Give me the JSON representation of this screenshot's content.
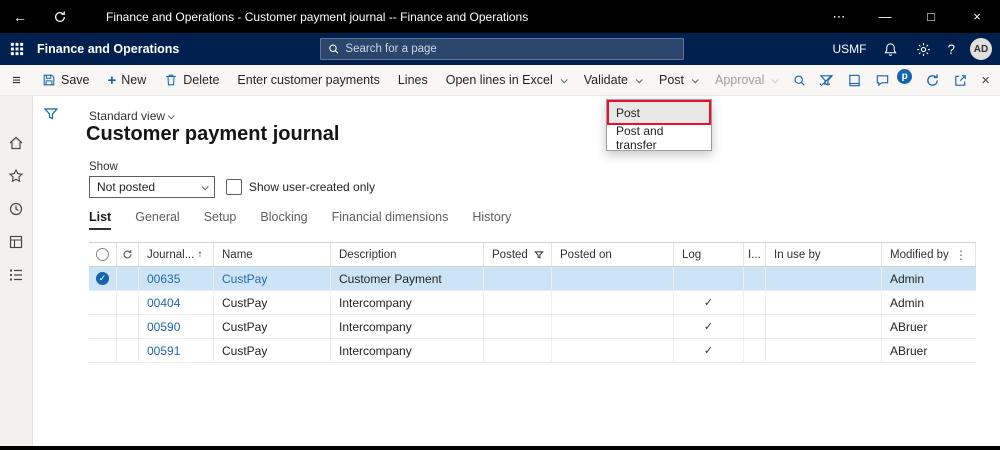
{
  "titlebar": {
    "title": "Finance and Operations - Customer payment journal -- Finance and Operations",
    "back": "←",
    "more": "⋯",
    "minimize": "—",
    "maximize": "□",
    "close": "×"
  },
  "navbar": {
    "app_name": "Finance and Operations",
    "search_placeholder": "Search for a page",
    "company": "USMF",
    "help": "?",
    "avatar_initials": "AD"
  },
  "actionbar": {
    "save": "Save",
    "new_plus": "+",
    "new": "New",
    "delete": "Delete",
    "enter_customer_payments": "Enter customer payments",
    "lines": "Lines",
    "open_lines_in_excel": "Open lines in Excel",
    "validate": "Validate",
    "post": "Post",
    "approval": "Approval",
    "overflow": "…",
    "badge": "p",
    "close": "×"
  },
  "post_menu": {
    "post": "Post",
    "post_and_transfer": "Post and transfer"
  },
  "page": {
    "view_selector": "Standard view",
    "title": "Customer payment journal",
    "show_label": "Show",
    "show_filter_value": "Not posted",
    "user_created_label": "Show user-created only",
    "tabs": [
      "List",
      "General",
      "Setup",
      "Blocking",
      "Financial dimensions",
      "History"
    ]
  },
  "grid": {
    "headers": {
      "journal": "Journal...",
      "sort_arrow": "↑",
      "name": "Name",
      "description": "Description",
      "posted": "Posted",
      "posted_on": "Posted on",
      "log": "Log",
      "i": "I...",
      "in_use_by": "In use by",
      "modified_by": "Modified by",
      "more": "⋮"
    },
    "selected_check": "✓",
    "rows": [
      {
        "journal": "00635",
        "name": "CustPay",
        "description": "Customer Payment",
        "posted": "",
        "posted_on": "",
        "log": "",
        "in_use_by": "",
        "modified_by": "Admin"
      },
      {
        "journal": "00404",
        "name": "CustPay",
        "description": "Intercompany",
        "posted": "",
        "posted_on": "",
        "log": "✓",
        "in_use_by": "",
        "modified_by": "Admin"
      },
      {
        "journal": "00590",
        "name": "CustPay",
        "description": "Intercompany",
        "posted": "",
        "posted_on": "",
        "log": "✓",
        "in_use_by": "",
        "modified_by": "ABruer"
      },
      {
        "journal": "00591",
        "name": "CustPay",
        "description": "Intercompany",
        "posted": "",
        "posted_on": "",
        "log": "✓",
        "in_use_by": "",
        "modified_by": "ABruer"
      }
    ]
  }
}
